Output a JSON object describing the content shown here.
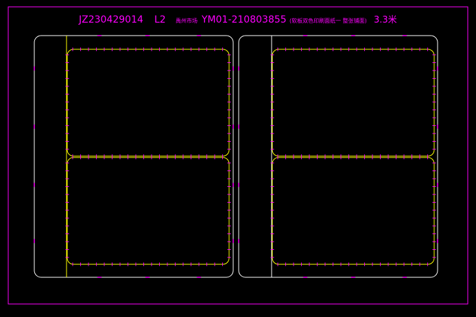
{
  "title": {
    "code": "JZ230429014",
    "level": "L2",
    "customer": "禹州市场",
    "model": "YM01-210803855",
    "desc": "(软板双色印刷面纸一 整张铺面)",
    "size": "3.3米"
  },
  "colors": {
    "background": "#000000",
    "frame": "#ff00ff",
    "outline": "#ffffff",
    "cavity": "#ffff00",
    "ticks": "#ff00ff"
  }
}
